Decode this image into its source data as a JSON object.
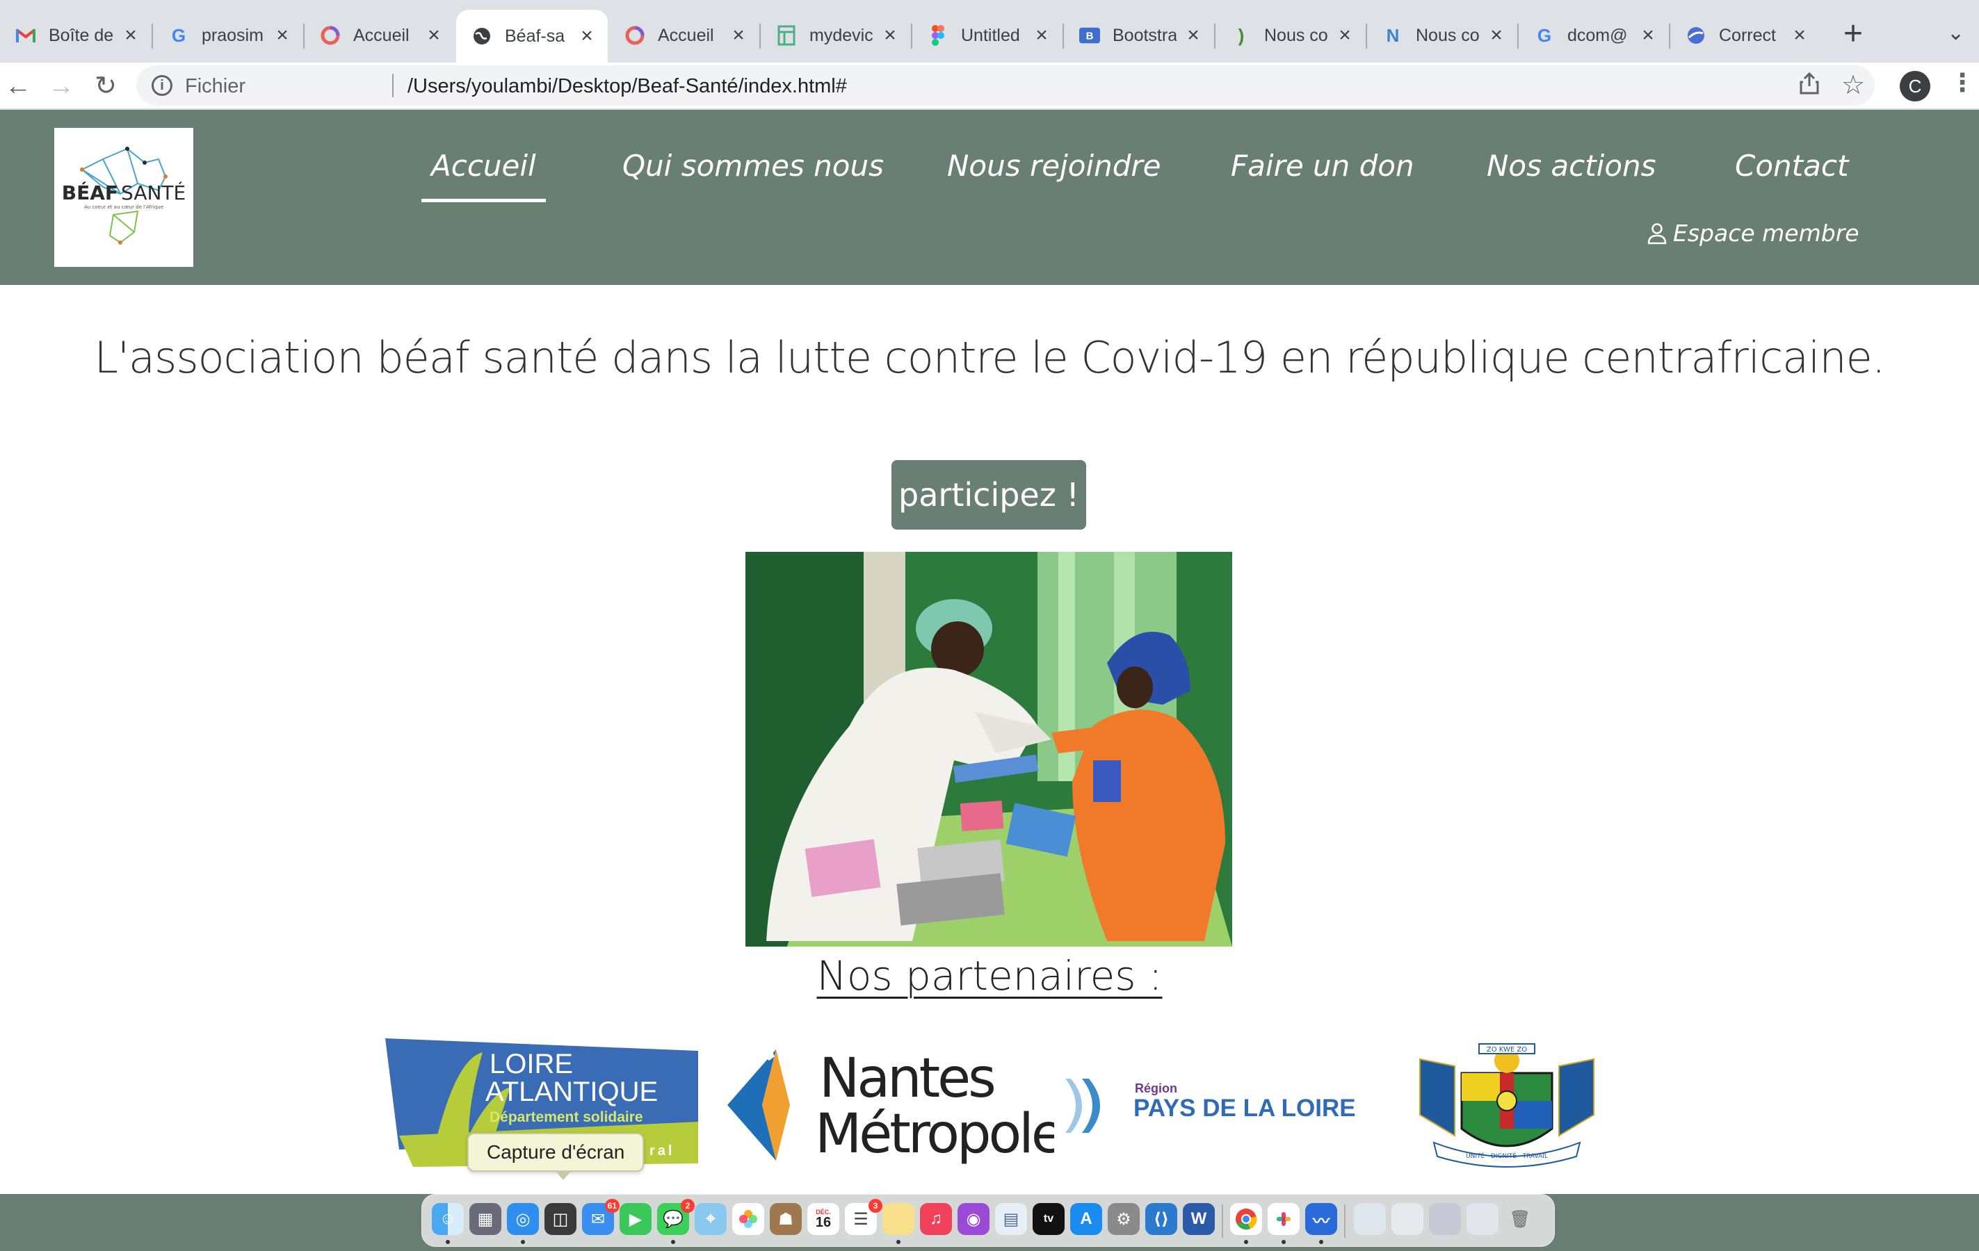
{
  "browser": {
    "tabs": [
      {
        "label": "Boîte de",
        "icon": "gmail-icon"
      },
      {
        "label": "praosim",
        "icon": "google-icon"
      },
      {
        "label": "Accueil",
        "icon": "circle-logo-icon"
      },
      {
        "label": "Béaf-sa",
        "icon": "globe-icon",
        "active": true
      },
      {
        "label": "Accueil",
        "icon": "circle-logo-icon"
      },
      {
        "label": "mydevic",
        "icon": "document-icon"
      },
      {
        "label": "Untitled",
        "icon": "figma-icon"
      },
      {
        "label": "Bootstra",
        "icon": "bootstrap-icon"
      },
      {
        "label": "Nous co",
        "icon": "bracket-icon"
      },
      {
        "label": "Nous co",
        "icon": "n-logo-icon"
      },
      {
        "label": "dcom@",
        "icon": "google-icon"
      },
      {
        "label": "Correct",
        "icon": "sphere-icon"
      }
    ],
    "new_tab": "+",
    "tab_list": "⌄",
    "back": "←",
    "forward": "→",
    "reload": "↻",
    "scheme_label": "Fichier",
    "url": "/Users/youlambi/Desktop/Beaf-Santé/index.html#",
    "profile_initial": "C"
  },
  "site": {
    "logo": {
      "word1": "BÉAF",
      "word2": "SANTÉ",
      "tagline": "Au coeur et au cœur de l'Afrique"
    },
    "nav": [
      {
        "label": "Accueil",
        "active": true
      },
      {
        "label": "Qui sommes nous"
      },
      {
        "label": "Nous rejoindre"
      },
      {
        "label": "Faire un don"
      },
      {
        "label": "Nos actions"
      },
      {
        "label": "Contact"
      }
    ],
    "member_label": "Espace membre",
    "headline": "L'association béaf santé dans la lutte contre le Covid-19 en république centrafricaine.",
    "cta_label": "participez !",
    "partners_title": "Nos partenaires :",
    "partners": {
      "loire": {
        "line1": "LOIRE",
        "line2": "ATLANTIQUE",
        "line3": "Département solidaire",
        "tail": "ral"
      },
      "nantes": {
        "line1": "Nantes",
        "line2": "Métropole"
      },
      "region": {
        "small": "Région",
        "big": "PAYS DE LA LOIRE"
      },
      "car": {
        "motto_top": "ZO KWE ZO",
        "motto_bottom": "UNITÉ · DIGNITÉ · TRAVAIL"
      }
    },
    "tooltip": "Capture d'écran"
  },
  "dock": {
    "calendar_month": "DÉC.",
    "calendar_day": "16",
    "mail_badge": "61",
    "messages_badge": "2",
    "reminders_badge": "3",
    "tv_label": "tv"
  },
  "colors": {
    "header_green": "#6a7f73",
    "chrome_bg": "#dee1e6"
  }
}
